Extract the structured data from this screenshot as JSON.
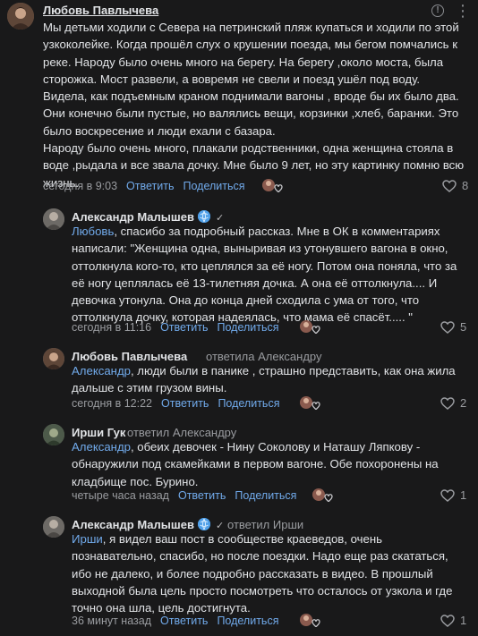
{
  "comments": [
    {
      "author": "Любовь Павлычева",
      "reply_to": "",
      "lines": [
        "Мы детьми ходили с Севера на петринский пляж купаться и ходили по этой",
        "узкоколейке. Когда прошёл слух о крушении поезда, мы бегом помчались к",
        "реке. Народу было очень много на берегу. На берегу ,около моста, была",
        "сторожка. Мост развели, а вовремя не свели и поезд ушёл под воду.",
        "Видела, как подъемным краном поднимали вагоны , вроде бы их было два.",
        "Они конечно были пустые, но валялись вещи, корзинки ,хлеб, баранки. Это",
        "было воскресение и люди ехали с базара.",
        "Народу было очень много, плакали родственники, одна женщина стояла в",
        "воде ,рыдала и все звала дочку. Мне было 9 лет, но эту картинку помню всю",
        "жизнь."
      ],
      "time": "сегодня в 9:03",
      "reply_label": "Ответить",
      "share_label": "Поделиться",
      "likes": "8"
    },
    {
      "author": "Александр Малышев",
      "reply_to": "",
      "mention": "Любовь",
      "lines": [
        ", спасибо за подробный рассказ. Мне в ОК в комментариях",
        "написали: \"Женщина одна, выныривая из утонувшего вагона в окно,",
        "оттолкнула кого-то, кто цеплялся за её ногу. Потом она поняла, что за",
        "её ногу цеплялась её 13-тилетняя дочка. А она её оттолкнула.... И",
        "девочка утонула. Она до конца дней сходила с ума от того, что",
        "оттолкнула дочку, которая надеялась, что мама её спасёт..... \""
      ],
      "time": "сегодня в 11:16",
      "reply_label": "Ответить",
      "share_label": "Поделиться",
      "likes": "5"
    },
    {
      "author": "Любовь Павлычева",
      "reply_to": "ответила Александру",
      "mention": "Александр",
      "lines": [
        ", люди были в панике , страшно представить, как она жила",
        "дальше с этим грузом вины."
      ],
      "time": "сегодня в 12:22",
      "reply_label": "Ответить",
      "share_label": "Поделиться",
      "likes": "2"
    },
    {
      "author": "Ирши Гук",
      "reply_to": "ответил Александру",
      "mention": "Александр",
      "lines": [
        ", обеих девочек - Нину Соколову и Наташу Ляпкову -",
        "обнаружили под скамейками в первом вагоне. Обе похоронены на",
        "кладбище пос. Бурино."
      ],
      "time": "четыре часа назад",
      "reply_label": "Ответить",
      "share_label": "Поделиться",
      "likes": "1"
    },
    {
      "author": "Александр Малышев",
      "reply_to": "ответил Ирши",
      "mention": "Ирши",
      "lines": [
        ", я видел ваш пост в сообществе краеведов, очень",
        "познавательно, спасибо, но после поездки. Надо еще раз скататься,",
        "ибо не далеко, и более подробно рассказать в видео. В прошлый",
        "выходной была цель просто посмотреть что осталось от узкола и где",
        "точно она шла, цель достигнута."
      ],
      "time": "36 минут назад",
      "reply_label": "Ответить",
      "share_label": "Поделиться",
      "likes": "1"
    }
  ],
  "icons": {
    "info": "info-icon",
    "menu": "more-vertical-icon",
    "like": "heart-icon",
    "verified": "check-icon",
    "badge": "vk-globe-icon"
  },
  "colors": {
    "background": "#19191a",
    "text": "#e1e3e6",
    "link": "#71aaeb",
    "secondary": "#9a9ca0"
  }
}
